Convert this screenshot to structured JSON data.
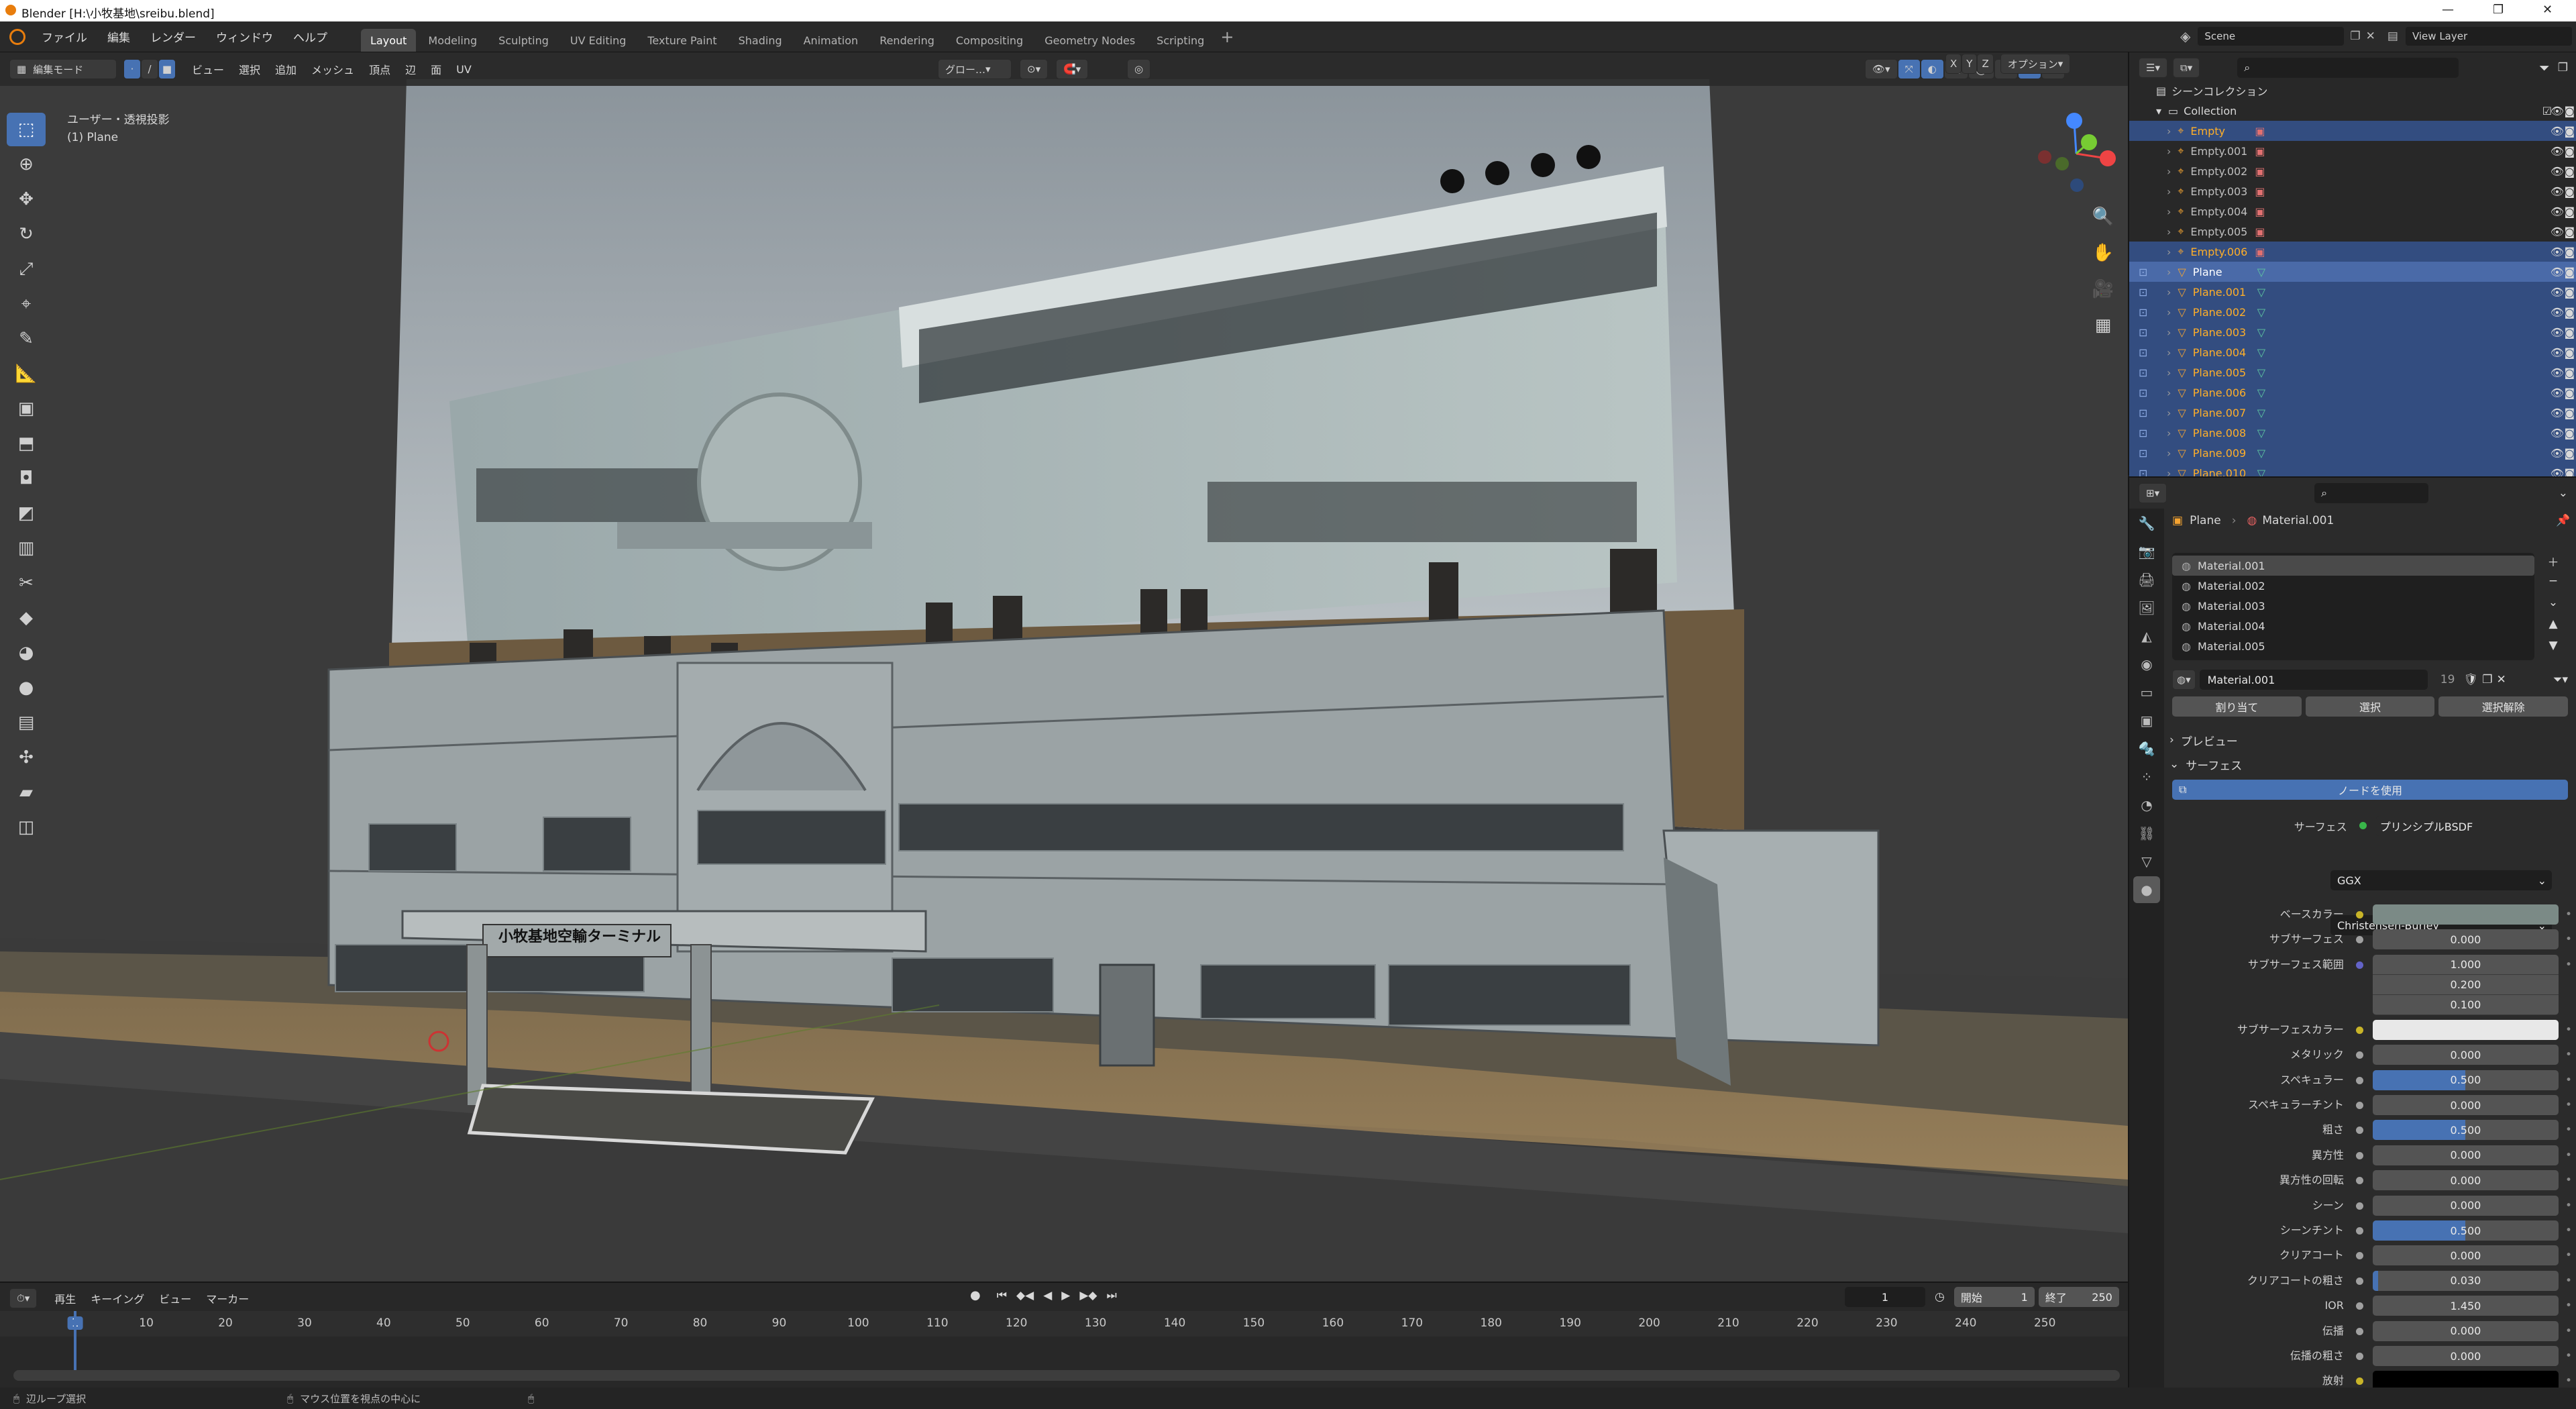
{
  "window": {
    "title": "Blender [H:\\小牧基地\\sreibu.blend]"
  },
  "menu": [
    "ファイル",
    "編集",
    "レンダー",
    "ウィンドウ",
    "ヘルプ"
  ],
  "workspaces": [
    "Layout",
    "Modeling",
    "Sculpting",
    "UV Editing",
    "Texture Paint",
    "Shading",
    "Animation",
    "Rendering",
    "Compositing",
    "Geometry Nodes",
    "Scripting"
  ],
  "active_workspace": "Layout",
  "scene": {
    "name": "Scene",
    "view_layer": "View Layer"
  },
  "viewport": {
    "mode": "編集モード",
    "menus": [
      "ビュー",
      "選択",
      "追加",
      "メッシュ",
      "頂点",
      "辺",
      "面",
      "UV"
    ],
    "overlay_title": "ユーザー・透視投影",
    "overlay_object": "(1) Plane",
    "transform": "グロー…",
    "options": "オプション",
    "axes": [
      "X",
      "Y",
      "Z"
    ],
    "sign_text": "小牧基地空輸ターミナル"
  },
  "timeline": {
    "menus": [
      "再生",
      "キーイング",
      "ビュー",
      "マーカー"
    ],
    "current_frame": "1",
    "start_label": "開始",
    "start": "1",
    "end_label": "終了",
    "end": "250",
    "ticks": [
      "1",
      "10",
      "20",
      "30",
      "40",
      "50",
      "60",
      "70",
      "80",
      "90",
      "100",
      "110",
      "120",
      "130",
      "140",
      "150",
      "160",
      "170",
      "180",
      "190",
      "200",
      "210",
      "220",
      "230",
      "240",
      "250"
    ]
  },
  "statusbar": {
    "left": "辺ループ選択",
    "middle": "マウス位置を視点の中心に"
  },
  "outliner": {
    "title": "シーンコレクション",
    "collection": "Collection",
    "items": [
      {
        "name": "Empty",
        "type": "empty",
        "selected": true
      },
      {
        "name": "Empty.001",
        "type": "empty",
        "selected": false
      },
      {
        "name": "Empty.002",
        "type": "empty",
        "selected": false
      },
      {
        "name": "Empty.003",
        "type": "empty",
        "selected": false
      },
      {
        "name": "Empty.004",
        "type": "empty",
        "selected": false
      },
      {
        "name": "Empty.005",
        "type": "empty",
        "selected": false
      },
      {
        "name": "Empty.006",
        "type": "empty",
        "selected": true
      },
      {
        "name": "Plane",
        "type": "mesh",
        "selected": true,
        "active": true
      },
      {
        "name": "Plane.001",
        "type": "mesh",
        "selected": true
      },
      {
        "name": "Plane.002",
        "type": "mesh",
        "selected": true
      },
      {
        "name": "Plane.003",
        "type": "mesh",
        "selected": true
      },
      {
        "name": "Plane.004",
        "type": "mesh",
        "selected": true
      },
      {
        "name": "Plane.005",
        "type": "mesh",
        "selected": true
      },
      {
        "name": "Plane.006",
        "type": "mesh",
        "selected": true
      },
      {
        "name": "Plane.007",
        "type": "mesh",
        "selected": true
      },
      {
        "name": "Plane.008",
        "type": "mesh",
        "selected": true
      },
      {
        "name": "Plane.009",
        "type": "mesh",
        "selected": true
      },
      {
        "name": "Plane.010",
        "type": "mesh",
        "selected": true
      }
    ]
  },
  "properties": {
    "object": "Plane",
    "material": "Material.001",
    "slots": [
      "Material.001",
      "Material.002",
      "Material.003",
      "Material.004",
      "Material.005"
    ],
    "users": "19",
    "buttons": {
      "assign": "割り当て",
      "select": "選択",
      "deselect": "選択解除",
      "use_nodes": "ノードを使用"
    },
    "panels": {
      "preview": "プレビュー",
      "surface": "サーフェス"
    },
    "surface_label": "サーフェス",
    "surface_shader": "プリンシプルBSDF",
    "distribution": "GGX",
    "subsurface_method": "Christensen-Burley",
    "fields": [
      {
        "label": "ベースカラー",
        "kind": "color",
        "color": "#7b8a86",
        "dot": "#c8b428"
      },
      {
        "label": "サブサーフェス",
        "value": "0.000",
        "dot": "#a0a0a0"
      },
      {
        "label": "サブサーフェス範囲",
        "kind": "vector",
        "values": [
          "1.000",
          "0.200",
          "0.100"
        ],
        "dot": "#6363c7"
      },
      {
        "label": "サブサーフェスカラー",
        "kind": "color",
        "color": "#e8e8e8",
        "dot": "#c8b428"
      },
      {
        "label": "メタリック",
        "value": "0.000",
        "dot": "#a0a0a0"
      },
      {
        "label": "スペキュラー",
        "value": "0.500",
        "fill": 0.5,
        "dot": "#a0a0a0"
      },
      {
        "label": "スペキュラーチント",
        "value": "0.000",
        "dot": "#a0a0a0"
      },
      {
        "label": "粗さ",
        "value": "0.500",
        "fill": 0.5,
        "dot": "#a0a0a0"
      },
      {
        "label": "異方性",
        "value": "0.000",
        "dot": "#a0a0a0"
      },
      {
        "label": "異方性の回転",
        "value": "0.000",
        "dot": "#a0a0a0"
      },
      {
        "label": "シーン",
        "value": "0.000",
        "dot": "#a0a0a0"
      },
      {
        "label": "シーンチント",
        "value": "0.500",
        "fill": 0.5,
        "dot": "#a0a0a0"
      },
      {
        "label": "クリアコート",
        "value": "0.000",
        "dot": "#a0a0a0"
      },
      {
        "label": "クリアコートの粗さ",
        "value": "0.030",
        "fill": 0.03,
        "dot": "#a0a0a0"
      },
      {
        "label": "IOR",
        "value": "1.450",
        "dot": "#a0a0a0"
      },
      {
        "label": "伝播",
        "value": "0.000",
        "dot": "#a0a0a0"
      },
      {
        "label": "伝播の粗さ",
        "value": "0.000",
        "dot": "#a0a0a0"
      },
      {
        "label": "放射",
        "kind": "color",
        "color": "#000000",
        "dot": "#c8b428"
      }
    ]
  },
  "colors": {
    "accent": "#4772b3",
    "selected_row": "#334d80",
    "orange_text": "#ffaf29",
    "header": "#2a2a2a"
  }
}
